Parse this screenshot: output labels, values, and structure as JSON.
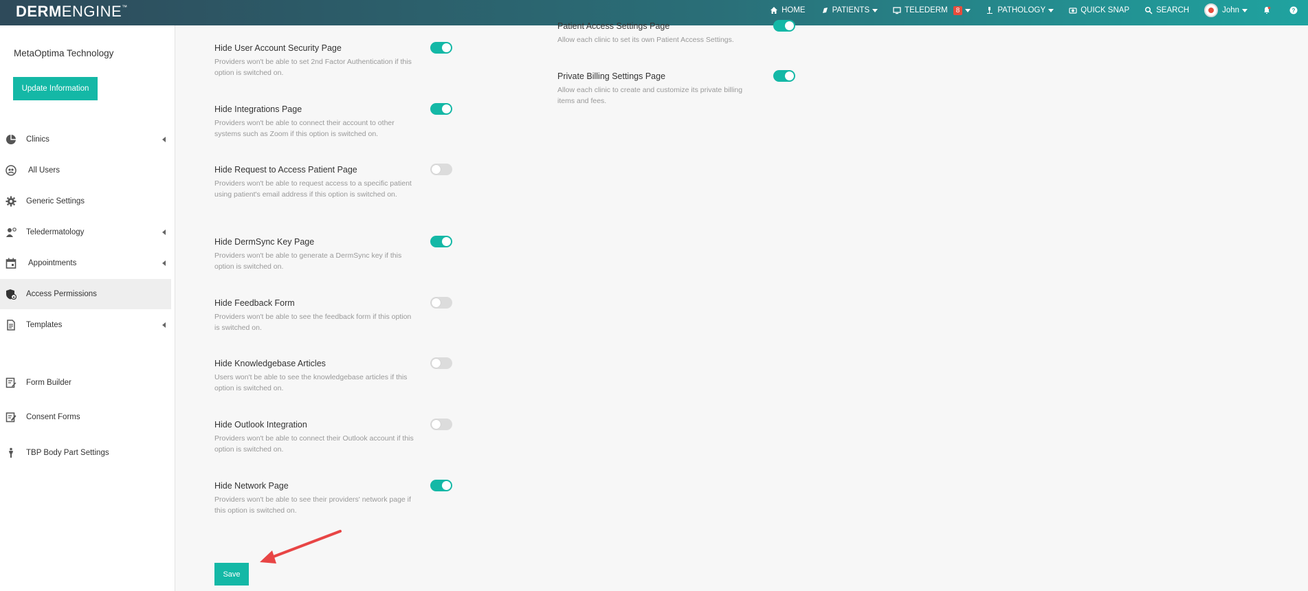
{
  "header": {
    "logo_bold": "DERM",
    "logo_light": "ENGINE",
    "logo_tm": "™",
    "nav": {
      "home": "HOME",
      "patients": "PATIENTS",
      "telederm": "TELEDERM",
      "telederm_badge": "8",
      "pathology": "PATHOLOGY",
      "quick_snap": "QUICK SNAP",
      "search": "SEARCH",
      "user": "John"
    }
  },
  "sidebar": {
    "org_name": "MetaOptima Technology",
    "update_button": "Update Information",
    "items": [
      {
        "label": "Clinics"
      },
      {
        "label": "All Users"
      },
      {
        "label": "Generic Settings"
      },
      {
        "label": "Teledermatology"
      },
      {
        "label": "Appointments"
      },
      {
        "label": "Access Permissions"
      },
      {
        "label": "Templates"
      },
      {
        "label": "Form Builder"
      },
      {
        "label": "Consent Forms"
      },
      {
        "label": "TBP Body Part Settings"
      }
    ]
  },
  "settings_left": [
    {
      "title": "Hide User Account Security Page",
      "desc": "Providers won't be able to set 2nd Factor Authentication if this option is switched on.",
      "enabled": true
    },
    {
      "title": "Hide Integrations Page",
      "desc": "Providers won't be able to connect their account to other systems such as Zoom if this option is switched on.",
      "enabled": true
    },
    {
      "title": "Hide Request to Access Patient Page",
      "desc": "Providers won't be able to request access to a specific patient using patient's email address if this option is switched on.",
      "enabled": false
    },
    {
      "title": "Hide DermSync Key Page",
      "desc": "Providers won't be able to generate a DermSync key if this option is switched on.",
      "enabled": true
    },
    {
      "title": "Hide Feedback Form",
      "desc": "Providers won't be able to see the feedback form if this option is switched on.",
      "enabled": false
    },
    {
      "title": "Hide Knowledgebase Articles",
      "desc": "Users won't be able to see the knowledgebase articles if this option is switched on.",
      "enabled": false
    },
    {
      "title": "Hide Outlook Integration",
      "desc": "Providers won't be able to connect their Outlook account if this option is switched on.",
      "enabled": false
    },
    {
      "title": "Hide Network Page",
      "desc": "Providers won't be able to see their providers' network page if this option is switched on.",
      "enabled": true
    }
  ],
  "settings_right": [
    {
      "title": "Patient Access Settings Page",
      "desc": "Allow each clinic to set its own Patient Access Settings.",
      "enabled": true
    },
    {
      "title": "Private Billing Settings Page",
      "desc": "Allow each clinic to create and customize its private billing items and fees.",
      "enabled": true
    }
  ],
  "save_button": "Save",
  "colors": {
    "accent": "#14b8a6",
    "annotation_arrow": "#e84545"
  }
}
